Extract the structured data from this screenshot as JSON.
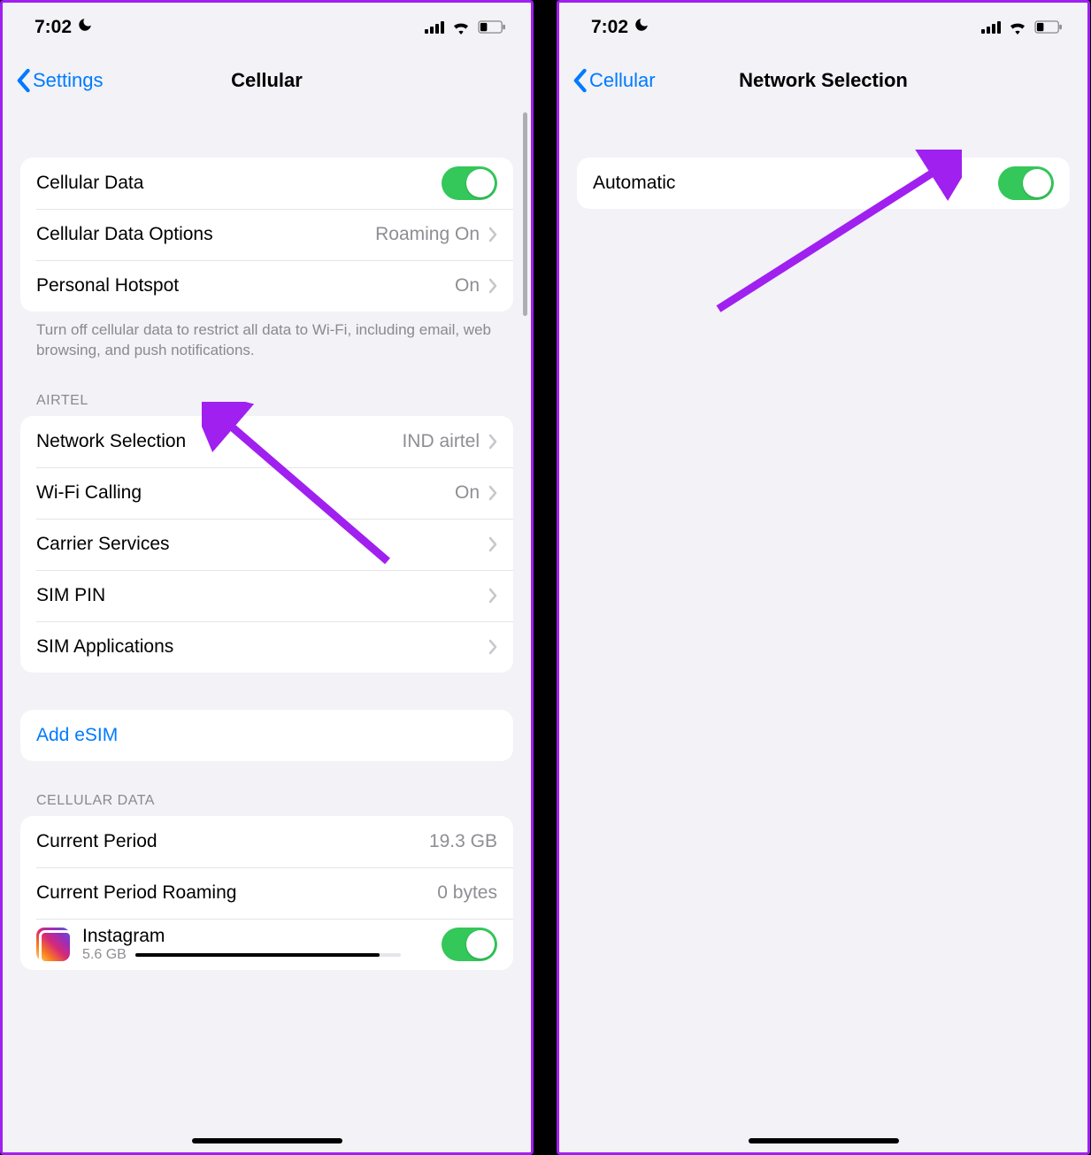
{
  "status": {
    "time": "7:02"
  },
  "left": {
    "back": "Settings",
    "title": "Cellular",
    "group1": {
      "cellular_data": "Cellular Data",
      "cellular_data_options": "Cellular Data Options",
      "cellular_data_options_value": "Roaming On",
      "personal_hotspot": "Personal Hotspot",
      "personal_hotspot_value": "On"
    },
    "footer1": "Turn off cellular data to restrict all data to Wi-Fi, including email, web browsing, and push notifications.",
    "carrier_header": "AIRTEL",
    "group2": {
      "network_selection": "Network Selection",
      "network_selection_value": "IND airtel",
      "wifi_calling": "Wi-Fi Calling",
      "wifi_calling_value": "On",
      "carrier_services": "Carrier Services",
      "sim_pin": "SIM PIN",
      "sim_applications": "SIM Applications"
    },
    "group3": {
      "add_esim": "Add eSIM"
    },
    "data_header": "CELLULAR DATA",
    "group4": {
      "current_period": "Current Period",
      "current_period_value": "19.3 GB",
      "current_period_roaming": "Current Period Roaming",
      "current_period_roaming_value": "0 bytes",
      "app_name": "Instagram",
      "app_size": "5.6 GB"
    }
  },
  "right": {
    "back": "Cellular",
    "title": "Network Selection",
    "row": {
      "automatic": "Automatic"
    }
  }
}
